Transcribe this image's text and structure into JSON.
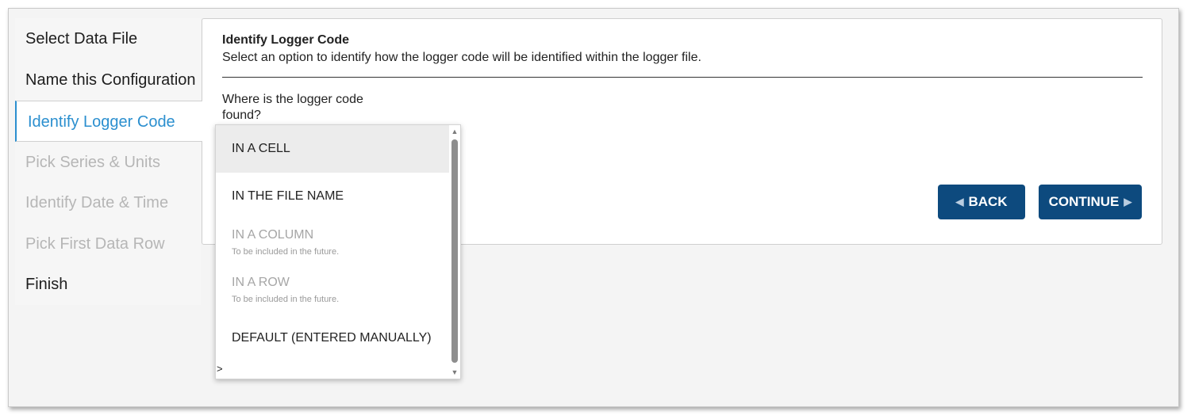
{
  "sidebar": {
    "steps": [
      {
        "label": "Select Data File",
        "state": "normal"
      },
      {
        "label": "Name this Configuration",
        "state": "normal"
      },
      {
        "label": "Identify Logger Code",
        "state": "active"
      },
      {
        "label": "Pick Series & Units",
        "state": "disabled"
      },
      {
        "label": "Identify Date & Time",
        "state": "disabled"
      },
      {
        "label": "Pick First Data Row",
        "state": "disabled"
      },
      {
        "label": "Finish",
        "state": "normal"
      }
    ]
  },
  "main": {
    "title": "Identify Logger Code",
    "subtitle": "Select an option to identify how the logger code will be identified within the logger file.",
    "question": "Where is the logger code found?",
    "back_label": "BACK",
    "continue_label": "CONTINUE"
  },
  "dropdown": {
    "options": [
      {
        "label": "IN A CELL",
        "hint": "",
        "state": "selected"
      },
      {
        "label": "IN THE FILE NAME",
        "hint": "",
        "state": "normal"
      },
      {
        "label": "IN A COLUMN",
        "hint": "To be included in the future.",
        "state": "disabled"
      },
      {
        "label": "IN A ROW",
        "hint": "To be included in the future.",
        "state": "disabled"
      },
      {
        "label": "DEFAULT (ENTERED MANUALLY)",
        "hint": "",
        "state": "normal"
      }
    ],
    "tail_text": ">"
  },
  "colors": {
    "accent": "#2b8fcf",
    "button": "#0d4a7e",
    "disabled_text": "#b6b6b6"
  },
  "icons": {
    "back": "triangle-left-icon",
    "continue": "triangle-right-icon",
    "scroll_up": "scroll-up-arrow-icon",
    "scroll_down": "scroll-down-arrow-icon"
  }
}
